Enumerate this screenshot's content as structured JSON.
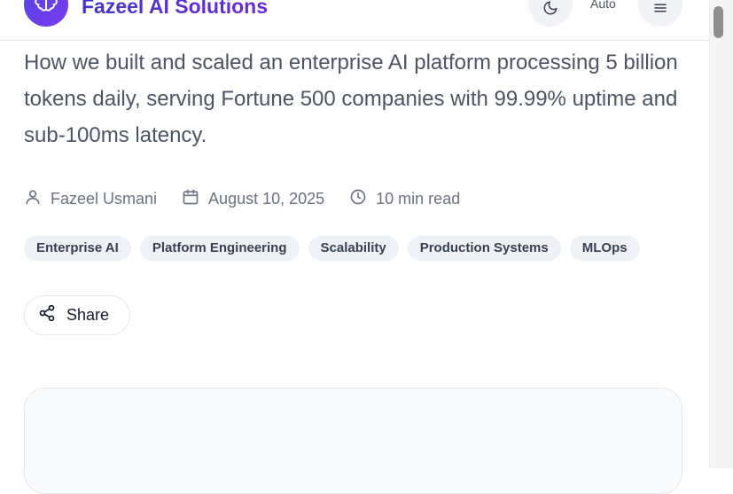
{
  "header": {
    "brand": "Fazeel AI Solutions",
    "theme_mode_label": "Auto"
  },
  "article": {
    "summary": "How we built and scaled an enterprise AI platform processing 5 billion tokens daily, serving Fortune 500 companies with 99.99% uptime and sub-100ms latency.",
    "author": "Fazeel Usmani",
    "date": "August 10, 2025",
    "read_time": "10 min read",
    "tags": [
      "Enterprise AI",
      "Platform Engineering",
      "Scalability",
      "Production Systems",
      "MLOps"
    ],
    "share_label": "Share"
  },
  "icons": {
    "logo": "brain-icon",
    "theme": "moon-icon",
    "menu": "menu-icon",
    "author": "user-icon",
    "date": "calendar-icon",
    "read_time": "clock-icon",
    "share": "share-icon"
  },
  "colors": {
    "brand_gradient_start": "#4338ca",
    "brand_gradient_end": "#6d28d9",
    "tag_background": "#eef1f5"
  }
}
